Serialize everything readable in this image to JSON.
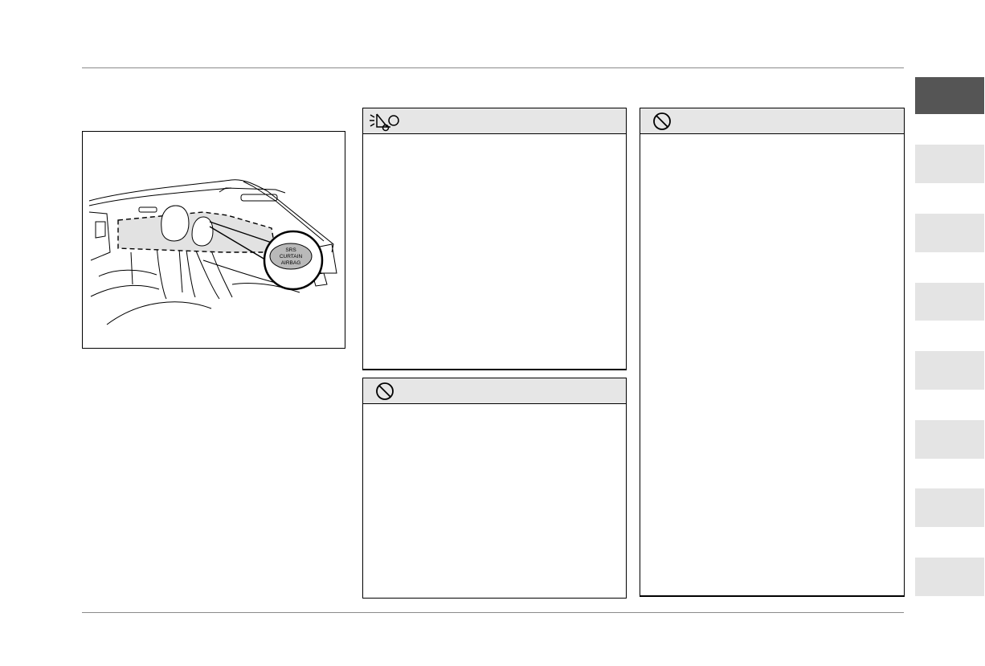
{
  "figure": {
    "callout_lines": [
      "SRS",
      "CURTAIN",
      "AIRBAG"
    ]
  },
  "boxes": {
    "warning": {
      "icon": "warning-hazard-icon"
    },
    "prohibition_1": {
      "icon": "prohibition-icon"
    },
    "prohibition_2": {
      "icon": "prohibition-icon"
    }
  },
  "side_tabs": {
    "count": 8,
    "active_index": 0,
    "active_color": "#555555",
    "inactive_color": "#e4e4e4"
  },
  "colors": {
    "header_fill": "#e6e6e6",
    "rule": "#8a8a8a"
  }
}
